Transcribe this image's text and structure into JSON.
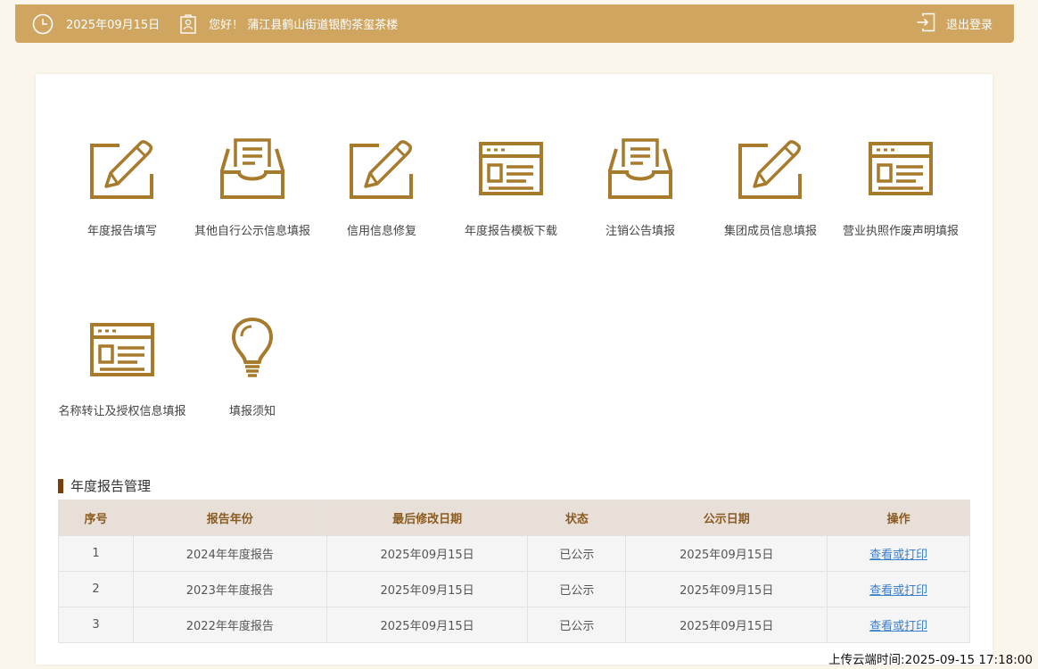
{
  "header": {
    "date": "2025年09月15日",
    "greeting": "您好！ 蒲江县鹤山街道银酌茶玺茶楼",
    "logout_label": "退出登录"
  },
  "tiles": [
    {
      "label": "年度报告填写",
      "icon": "pencil-edit-icon"
    },
    {
      "label": "其他自行公示信息填报",
      "icon": "inbox-document-icon"
    },
    {
      "label": "信用信息修复",
      "icon": "pencil-edit-icon"
    },
    {
      "label": "年度报告模板下载",
      "icon": "browser-window-icon"
    },
    {
      "label": "注销公告填报",
      "icon": "inbox-document-icon"
    },
    {
      "label": "集团成员信息填报",
      "icon": "pencil-edit-icon"
    },
    {
      "label": "营业执照作废声明填报",
      "icon": "browser-window-icon"
    },
    {
      "label": "名称转让及授权信息填报",
      "icon": "browser-window-icon"
    },
    {
      "label": "填报须知",
      "icon": "lightbulb-icon"
    }
  ],
  "section_title": "年度报告管理",
  "table": {
    "headers": [
      "序号",
      "报告年份",
      "最后修改日期",
      "状态",
      "公示日期",
      "操作"
    ],
    "rows": [
      {
        "no": "1",
        "year": "2024年年度报告",
        "modified": "2025年09月15日",
        "status": "已公示",
        "published": "2025年09月15日",
        "action": "查看或打印"
      },
      {
        "no": "2",
        "year": "2023年年度报告",
        "modified": "2025年09月15日",
        "status": "已公示",
        "published": "2025年09月15日",
        "action": "查看或打印"
      },
      {
        "no": "3",
        "year": "2022年年度报告",
        "modified": "2025年09月15日",
        "status": "已公示",
        "published": "2025年09月15日",
        "action": "查看或打印"
      }
    ]
  },
  "upload_time": "上传云端时间:2025-09-15 17:18:00",
  "colors": {
    "accent": "#cfa560",
    "icon": "#a77a2c",
    "section_bar": "#7a3d0c",
    "link": "#3a7fc9"
  }
}
